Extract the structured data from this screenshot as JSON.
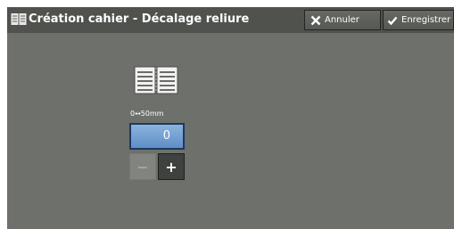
{
  "window": {
    "title": "Création cahier - Décalage reliure",
    "title_icon": "book-icon"
  },
  "toolbar": {
    "cancel_label": "Annuler",
    "cancel_icon": "close-x-icon",
    "save_label": "Enregistrer",
    "save_icon": "checkmark-icon"
  },
  "shift_control": {
    "illustration": "open-book-icon",
    "range_label": "0↔50mm",
    "value": "0",
    "decrease_label": "−",
    "increase_label": "+",
    "decrease_enabled": false,
    "increase_enabled": true
  },
  "colors": {
    "background": "#6d706b",
    "titlebar": "#4f524d",
    "value_field": "#6f9bd0",
    "plus_button": "#3e413d"
  }
}
